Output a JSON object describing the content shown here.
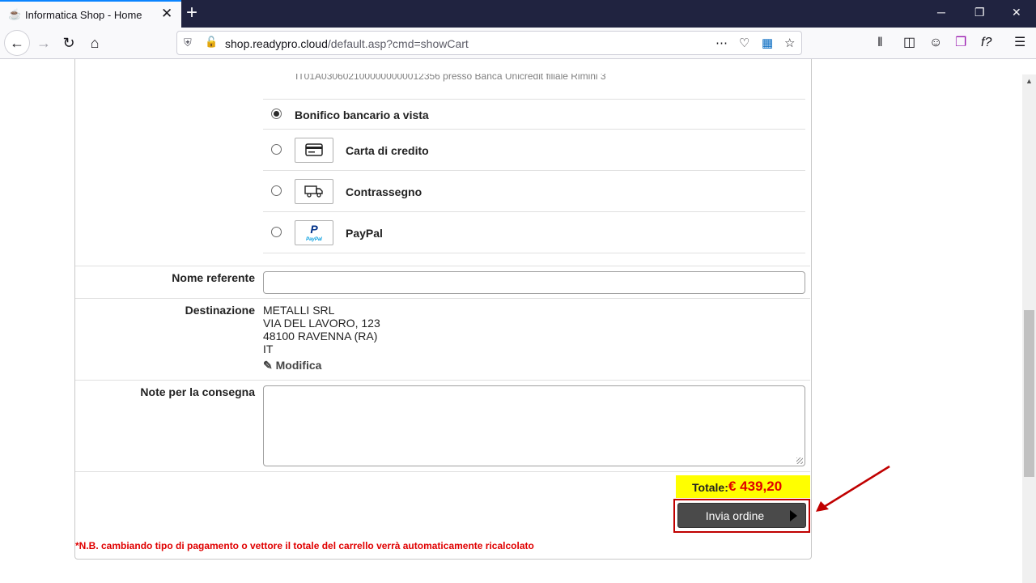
{
  "browser": {
    "tab_title": "Informatica Shop - Home",
    "tab_close": "✕",
    "new_tab": "+",
    "url_host": "shop.readypro.cloud",
    "url_path": "/default.asp?cmd=showCart"
  },
  "page": {
    "iban_text": "IT01A0306021000000000012356 presso Banca Unicredit filiale Rimini 3",
    "payment_methods": [
      {
        "label": "Bonifico bancario a vista",
        "selected": true
      },
      {
        "label": "Carta di credito",
        "selected": false
      },
      {
        "label": "Contrassegno",
        "selected": false
      },
      {
        "label": "PayPal",
        "selected": false
      }
    ],
    "nome_referente_label": "Nome referente",
    "destinazione_label": "Destinazione",
    "address_lines": [
      "METALLI SRL",
      "VIA DEL LAVORO, 123",
      "48100 RAVENNA (RA)",
      "IT"
    ],
    "modifica_label": "Modifica",
    "note_label": "Note per la consegna",
    "total_label": "Totale:",
    "total_value": "€ 439,20",
    "submit_label": "Invia ordine",
    "footnote": "*N.B. cambiando tipo di pagamento o vettore il totale del carrello verrà automaticamente ricalcolato"
  },
  "colors": {
    "total_bg": "#ffff00",
    "total_value": "#e00000",
    "annotation": "#c00000",
    "button_bg": "#4a4a4a"
  }
}
